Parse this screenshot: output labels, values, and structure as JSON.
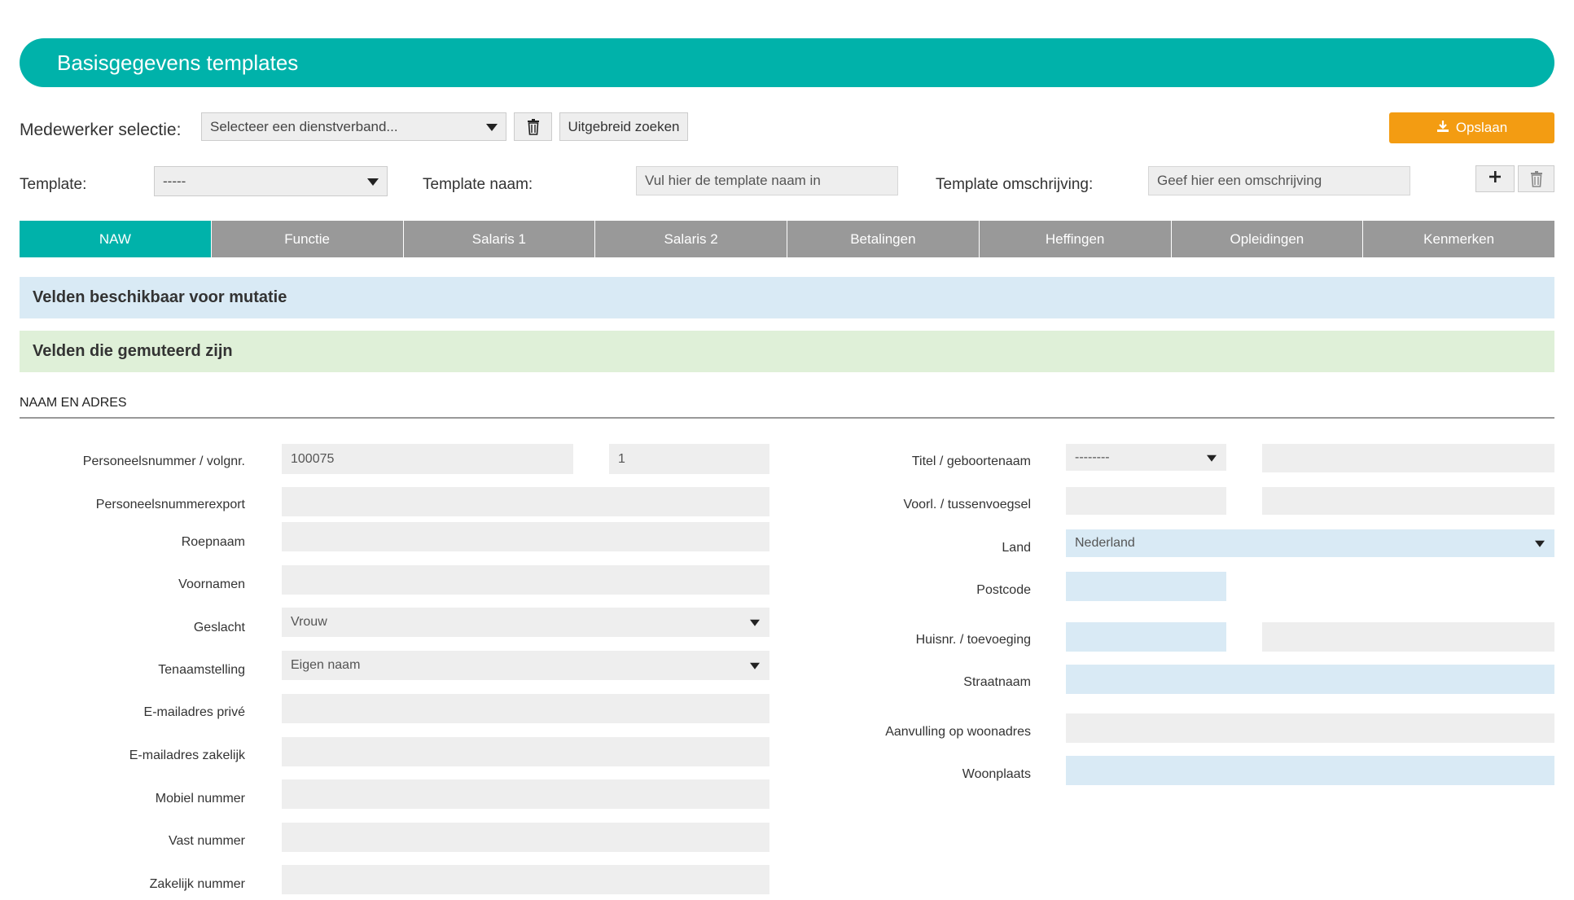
{
  "header": {
    "title": "Basisgegevens templates"
  },
  "toolbar": {
    "employee_label": "Medewerker selectie:",
    "employee_select": "Selecteer een dienstverband...",
    "advanced_search": "Uitgebreid zoeken",
    "save_label": "Opslaan",
    "template_label": "Template:",
    "template_select": "-----",
    "template_name_label": "Template naam:",
    "template_name_placeholder": "Vul hier de template naam in",
    "template_desc_label": "Template omschrijving:",
    "template_desc_placeholder": "Geef hier een omschrijving"
  },
  "tabs": [
    {
      "label": "NAW",
      "active": true
    },
    {
      "label": "Functie"
    },
    {
      "label": "Salaris 1"
    },
    {
      "label": "Salaris 2"
    },
    {
      "label": "Betalingen"
    },
    {
      "label": "Heffingen"
    },
    {
      "label": "Opleidingen"
    },
    {
      "label": "Kenmerken"
    }
  ],
  "panels": {
    "available": "Velden beschikbaar voor mutatie",
    "mutated": "Velden die gemuteerd zijn"
  },
  "section": {
    "title": "NAAM EN ADRES"
  },
  "left_fields": [
    {
      "label": "Personeelsnummer / volgnr.",
      "value": "100075",
      "value2": "1"
    },
    {
      "label": "Personeelsnummerexport",
      "value": ""
    },
    {
      "label": "Roepnaam",
      "value": ""
    },
    {
      "label": "Voornamen",
      "value": ""
    },
    {
      "label": "Geslacht",
      "value": "Vrouw"
    },
    {
      "label": "Tenaamstelling",
      "value": "Eigen naam"
    },
    {
      "label": "E-mailadres privé",
      "value": ""
    },
    {
      "label": "E-mailadres zakelijk",
      "value": ""
    },
    {
      "label": "Mobiel nummer",
      "value": ""
    },
    {
      "label": "Vast nummer",
      "value": ""
    },
    {
      "label": "Zakelijk nummer",
      "value": ""
    }
  ],
  "right_fields": [
    {
      "label": "Titel / geboortenaam",
      "value": "--------"
    },
    {
      "label": "Voorl. / tussenvoegsel",
      "value": ""
    },
    {
      "label": "Land",
      "value": "Nederland"
    },
    {
      "label": "Postcode",
      "value": ""
    },
    {
      "label": "Huisnr. / toevoeging",
      "value": ""
    },
    {
      "label": "Straatnaam",
      "value": ""
    },
    {
      "label": "Aanvulling op woonadres",
      "value": ""
    },
    {
      "label": "Woonplaats",
      "value": ""
    }
  ],
  "colors": {
    "accent": "#00b2aa",
    "save": "#f39c12",
    "tab_inactive": "#999999",
    "panel_blue": "#d9eaf5",
    "panel_green": "#dff0d8"
  }
}
